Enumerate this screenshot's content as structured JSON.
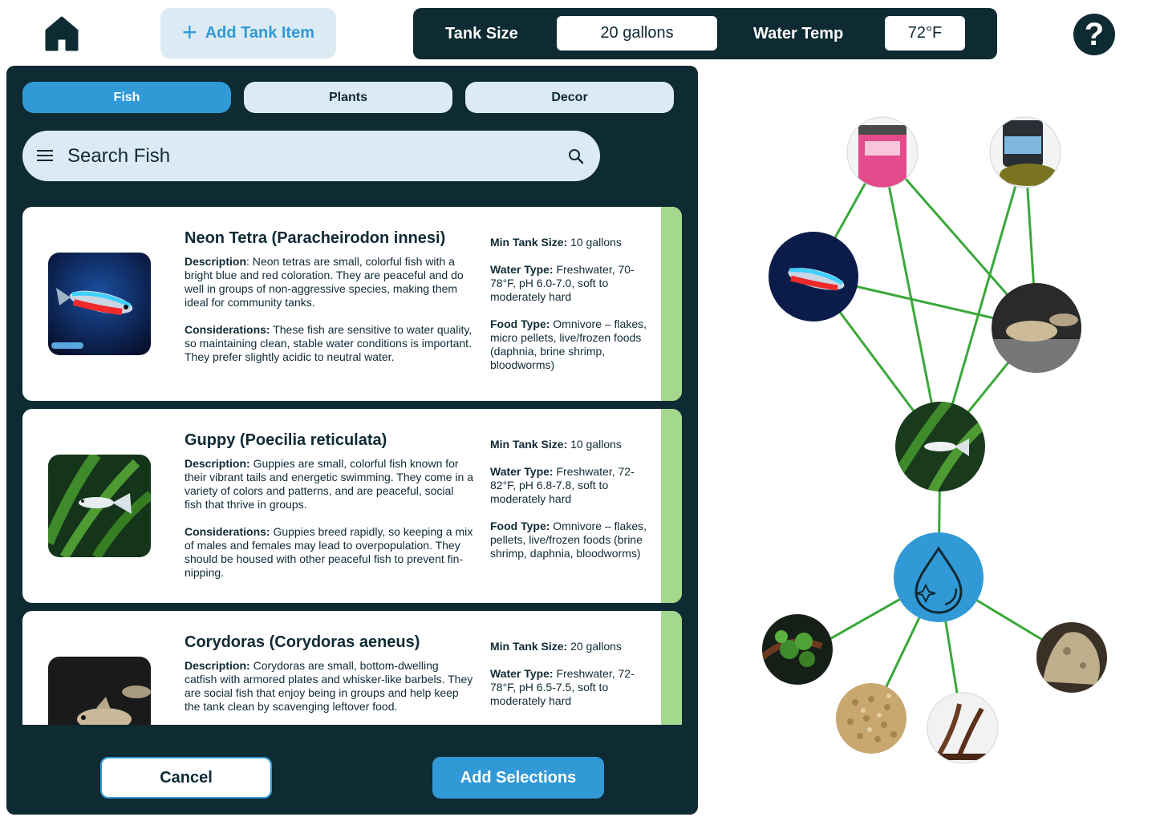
{
  "toolbar": {
    "home_icon": "home-icon",
    "add_tank_item_label": "Add Tank Item",
    "help_icon": "help-icon",
    "help_glyph": "?"
  },
  "tank_settings": {
    "tank_size_label": "Tank Size",
    "tank_size_value": "20 gallons",
    "water_temp_label": "Water Temp",
    "water_temp_value": "72°F"
  },
  "tabs": [
    {
      "label": "Fish",
      "active": true
    },
    {
      "label": "Plants",
      "active": false
    },
    {
      "label": "Decor",
      "active": false
    }
  ],
  "search": {
    "placeholder": "Search Fish",
    "menu_icon": "menu-icon",
    "search_icon": "search-icon"
  },
  "fish": [
    {
      "name": "Neon Tetra (Paracheirodon innesi)",
      "description_label": "Description",
      "description": ": Neon tetras are small, colorful fish with a bright blue and red coloration. They are peaceful and do well in groups of non-aggressive species, making them ideal for community tanks.",
      "considerations_label": "Considerations:",
      "considerations": " These fish are sensitive to water quality, so maintaining clean, stable water conditions is important. They prefer slightly acidic to neutral water.",
      "min_tank_label": "Min Tank Size:",
      "min_tank": " 10 gallons",
      "water_type_label": "Water Type:",
      "water_type": " Freshwater, 70-78°F, pH 6.0-7.0, soft to moderately hard",
      "food_type_label": "Food Type:",
      "food_type": " Omnivore – flakes, micro pellets, live/frozen foods (daphnia, brine shrimp, bloodworms)",
      "selected": true
    },
    {
      "name": "Guppy (Poecilia reticulata)",
      "description_label": "Description:",
      "description": " Guppies are small, colorful fish known for their vibrant tails and energetic swimming. They come in a variety of colors and patterns, and are peaceful, social fish that thrive in groups.",
      "considerations_label": "Considerations:",
      "considerations": " Guppies breed rapidly, so keeping a mix of males and females may lead to overpopulation. They should be housed with other peaceful fish to prevent fin-nipping.",
      "min_tank_label": "Min Tank Size:",
      "min_tank": " 10 gallons",
      "water_type_label": "Water Type:",
      "water_type": " Freshwater, 72-82°F, pH 6.8-7.8, soft to moderately hard",
      "food_type_label": "Food Type:",
      "food_type": " Omnivore – flakes, pellets, live/frozen foods (brine shrimp, daphnia, bloodworms)",
      "selected": true
    },
    {
      "name": "Corydoras (Corydoras aeneus)",
      "description_label": "Description:",
      "description": " Corydoras are small, bottom-dwelling catfish with armored plates and whisker-like barbels. They are social fish that enjoy being in groups and help keep the tank clean by scavenging leftover food.",
      "considerations_label": "",
      "considerations": "",
      "min_tank_label": "Min Tank Size:",
      "min_tank": " 20 gallons",
      "water_type_label": "Water Type:",
      "water_type": " Freshwater, 72-78°F, pH 6.5-7.5, soft to moderately hard",
      "food_type_label": "",
      "food_type": "",
      "selected": true
    }
  ],
  "actions": {
    "cancel_label": "Cancel",
    "add_selections_label": "Add Selections"
  },
  "graph": {
    "center_icon": "water-drop-icon",
    "edge_color": "#3aa83a",
    "nodes": [
      {
        "id": "bloodworms",
        "icon": "bloodworms-food-icon"
      },
      {
        "id": "sinking-pellets",
        "icon": "sinking-pellets-food-icon"
      },
      {
        "id": "neon-tetra",
        "icon": "neon-tetra-icon"
      },
      {
        "id": "corydoras",
        "icon": "corydoras-icon"
      },
      {
        "id": "guppy",
        "icon": "guppy-icon"
      },
      {
        "id": "water",
        "icon": "water-drop-icon"
      },
      {
        "id": "plant",
        "icon": "plant-icon"
      },
      {
        "id": "gravel",
        "icon": "gravel-icon"
      },
      {
        "id": "driftwood",
        "icon": "driftwood-icon"
      },
      {
        "id": "rock",
        "icon": "rock-icon"
      }
    ]
  },
  "colors": {
    "dark": "#0e2a33",
    "accent": "#3199d6",
    "light": "#dcebf3",
    "selected_strip": "#a3d88e"
  }
}
